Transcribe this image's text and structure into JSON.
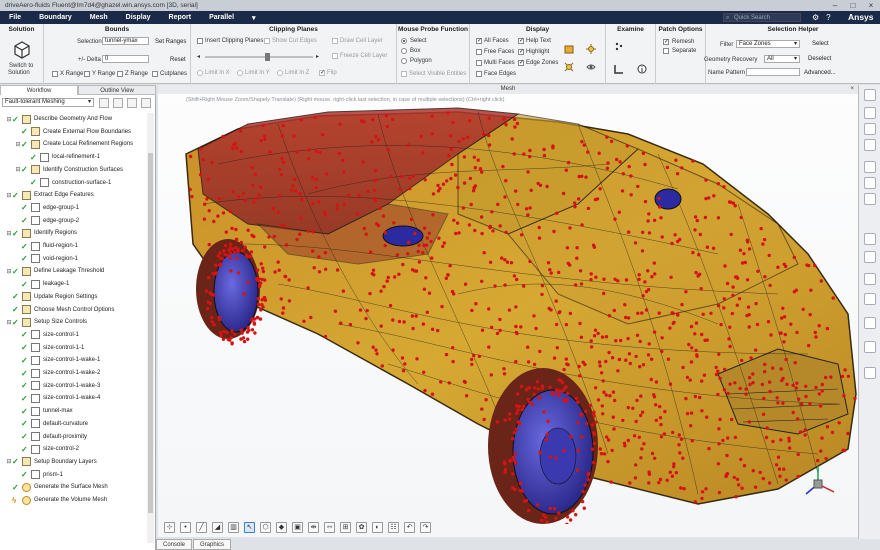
{
  "window": {
    "title": "driveAero-fluids Fluent@Im7d4@ghazel.win.ansys.com [3D, serial]"
  },
  "menu": {
    "items": [
      "File",
      "Boundary",
      "Mesh",
      "Display",
      "Report",
      "Parallel"
    ],
    "search_placeholder": "Quick Search",
    "brand": "Ansys"
  },
  "ribbon": {
    "solution": {
      "title": "Solution",
      "switch_label_1": "Switch to",
      "switch_label_2": "Solution"
    },
    "bounds": {
      "title": "Bounds",
      "selection_label": "Selection",
      "selection_value": "tunnel-ymax",
      "set_ranges": "Set Ranges",
      "delta_label": "+/- Delta",
      "delta_value": "0",
      "reset": "Reset",
      "x_range": "X Range",
      "y_range": "Y Range",
      "z_range": "Z Range",
      "cutplanes": "Cutplanes"
    },
    "clipping": {
      "title": "Clipping Planes",
      "insert": "Insert Clipping Planes",
      "show_cut": "Show Cut Edges",
      "limit_x": "Limit in X",
      "limit_y": "Limit in Y",
      "limit_z": "Limit in Z",
      "draw_cell": "Draw Cell Layer",
      "freeze_cell": "Freeze Cell Layer",
      "flip": "Flip"
    },
    "probe": {
      "title": "Mouse Probe Function",
      "select": "Select",
      "box": "Box",
      "polygon": "Polygon",
      "select_visible": "Select Visible Entities"
    },
    "display": {
      "title": "Display",
      "all_faces": "All Faces",
      "free_faces": "Free Faces",
      "multi_faces": "Multi Faces",
      "face_edges": "Face Edges",
      "help_text": "Help Text",
      "highlight": "Highlight",
      "edge_zones": "Edge Zones"
    },
    "examine": {
      "title": "Examine"
    },
    "patch": {
      "title": "Patch Options",
      "remesh": "Remesh",
      "separate": "Separate"
    },
    "helper": {
      "title": "Selection Helper",
      "filter_label": "Filter",
      "filter_value": "Face Zones",
      "select": "Select",
      "recovery_label": "Geometry Recovery",
      "recovery_value": "All",
      "deselect": "Deselect",
      "pattern_label": "Name Pattern",
      "advanced": "Advanced..."
    }
  },
  "left_panel": {
    "tabs": [
      "Workflow",
      "Outline View"
    ],
    "workflow_select": "Fault-tolerant Meshing",
    "tree": [
      {
        "label": "Describe Geometry And Flow",
        "level": 0,
        "exp": "⊟",
        "check": true,
        "icon": "task"
      },
      {
        "label": "Create External Flow Boundaries",
        "level": 1,
        "exp": "",
        "check": true,
        "icon": "task"
      },
      {
        "label": "Create Local Refinement Regions",
        "level": 1,
        "exp": "⊟",
        "check": true,
        "icon": "task"
      },
      {
        "label": "local-refinement-1",
        "level": 2,
        "exp": "",
        "check": true,
        "icon": "child"
      },
      {
        "label": "Identify Construction Surfaces",
        "level": 1,
        "exp": "⊟",
        "check": true,
        "icon": "task"
      },
      {
        "label": "construction-surface-1",
        "level": 2,
        "exp": "",
        "check": true,
        "icon": "child"
      },
      {
        "label": "Extract Edge Features",
        "level": 0,
        "exp": "⊟",
        "check": true,
        "icon": "task"
      },
      {
        "label": "edge-group-1",
        "level": 1,
        "exp": "",
        "check": true,
        "icon": "child"
      },
      {
        "label": "edge-group-2",
        "level": 1,
        "exp": "",
        "check": true,
        "icon": "child"
      },
      {
        "label": "Identify Regions",
        "level": 0,
        "exp": "⊟",
        "check": true,
        "icon": "task"
      },
      {
        "label": "fluid-region-1",
        "level": 1,
        "exp": "",
        "check": true,
        "icon": "child"
      },
      {
        "label": "void-region-1",
        "level": 1,
        "exp": "",
        "check": true,
        "icon": "child"
      },
      {
        "label": "Define Leakage Threshold",
        "level": 0,
        "exp": "⊟",
        "check": true,
        "icon": "task"
      },
      {
        "label": "leakage-1",
        "level": 1,
        "exp": "",
        "check": true,
        "icon": "child"
      },
      {
        "label": "Update Region Settings",
        "level": 0,
        "exp": "",
        "check": true,
        "icon": "task"
      },
      {
        "label": "Choose Mesh Control Options",
        "level": 0,
        "exp": "",
        "check": true,
        "icon": "task"
      },
      {
        "label": "Setup Size Controls",
        "level": 0,
        "exp": "⊟",
        "check": true,
        "icon": "task"
      },
      {
        "label": "size-control-1",
        "level": 1,
        "exp": "",
        "check": true,
        "icon": "child"
      },
      {
        "label": "size-control-1-1",
        "level": 1,
        "exp": "",
        "check": true,
        "icon": "child"
      },
      {
        "label": "size-control-1-wake-1",
        "level": 1,
        "exp": "",
        "check": true,
        "icon": "child"
      },
      {
        "label": "size-control-1-wake-2",
        "level": 1,
        "exp": "",
        "check": true,
        "icon": "child"
      },
      {
        "label": "size-control-1-wake-3",
        "level": 1,
        "exp": "",
        "check": true,
        "icon": "child"
      },
      {
        "label": "size-control-1-wake-4",
        "level": 1,
        "exp": "",
        "check": true,
        "icon": "child"
      },
      {
        "label": "tunnel-max",
        "level": 1,
        "exp": "",
        "check": true,
        "icon": "child"
      },
      {
        "label": "default-curvature",
        "level": 1,
        "exp": "",
        "check": true,
        "icon": "child"
      },
      {
        "label": "default-proximity",
        "level": 1,
        "exp": "",
        "check": true,
        "icon": "child"
      },
      {
        "label": "size-control-2",
        "level": 1,
        "exp": "",
        "check": true,
        "icon": "child"
      },
      {
        "label": "Setup Boundary Layers",
        "level": 0,
        "exp": "⊟",
        "check": true,
        "icon": "task"
      },
      {
        "label": "prism-1",
        "level": 1,
        "exp": "",
        "check": true,
        "icon": "child"
      },
      {
        "label": "Generate the Surface Mesh",
        "level": 0,
        "exp": "",
        "check": true,
        "icon": "ball"
      },
      {
        "label": "Generate the Volume Mesh",
        "level": 0,
        "exp": "",
        "check": false,
        "icon": "ball"
      }
    ]
  },
  "viewport": {
    "title": "Mesh",
    "hint": "(Shift+Right Mouse Zoom/Shapely Translate) (Right mouse, right-click last selection, in case of multiple selections) (Ctrl+right click)"
  },
  "bottom_tabs": [
    "Console",
    "Graphics"
  ],
  "colors": {
    "menubar": "#1b2a48",
    "body": "#c9a02a",
    "points": "#d41414",
    "wheel": "#3a38b8",
    "wire": "#1a1a1a"
  }
}
